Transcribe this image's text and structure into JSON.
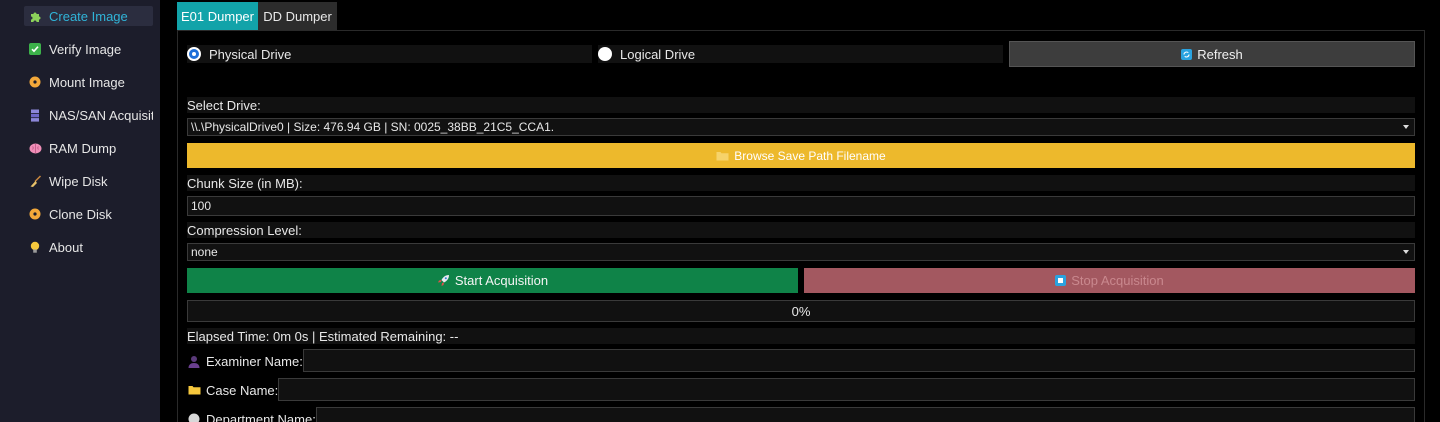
{
  "sidebar": {
    "items": [
      {
        "label": "Create Image",
        "icon": "puzzle-icon",
        "active": true
      },
      {
        "label": "Verify Image",
        "icon": "checkmark-icon"
      },
      {
        "label": "Mount Image",
        "icon": "disc-icon"
      },
      {
        "label": "NAS/SAN Acquisition",
        "icon": "server-icon"
      },
      {
        "label": "RAM Dump",
        "icon": "brain-icon"
      },
      {
        "label": "Wipe Disk",
        "icon": "broom-icon"
      },
      {
        "label": "Clone Disk",
        "icon": "clone-disc-icon"
      },
      {
        "label": "About",
        "icon": "lightbulb-icon"
      }
    ]
  },
  "tabs": [
    {
      "label": "E01 Dumper",
      "active": true
    },
    {
      "label": "DD Dumper"
    }
  ],
  "source": {
    "physical_label": "Physical Drive",
    "logical_label": "Logical Drive",
    "selected": "physical",
    "refresh_label": "Refresh"
  },
  "drive": {
    "label": "Select Drive:",
    "value": "\\\\.\\PhysicalDrive0 | Size: 476.94 GB | SN: 0025_38BB_21C5_CCA1."
  },
  "browse_label": "Browse Save Path Filename",
  "chunk": {
    "label": "Chunk Size (in MB):",
    "value": "100"
  },
  "compression": {
    "label": "Compression Level:",
    "value": "none"
  },
  "actions": {
    "start_label": "Start Acquisition",
    "stop_label": "Stop Acquisition"
  },
  "progress": {
    "value": 0,
    "text": "0%"
  },
  "status": {
    "elapsed_text": "Elapsed Time: 0m 0s | Estimated Remaining: --"
  },
  "case_info": {
    "examiner_label": "Examiner Name:",
    "examiner_value": "",
    "case_label": "Case Name:",
    "case_value": "",
    "department_label": "Department Name:",
    "department_value": ""
  },
  "colors": {
    "accent": "#12a3a9",
    "browse": "#edb92c",
    "start": "#0f8348",
    "stop": "#a35860",
    "active_nav_text": "#30b4d8"
  }
}
